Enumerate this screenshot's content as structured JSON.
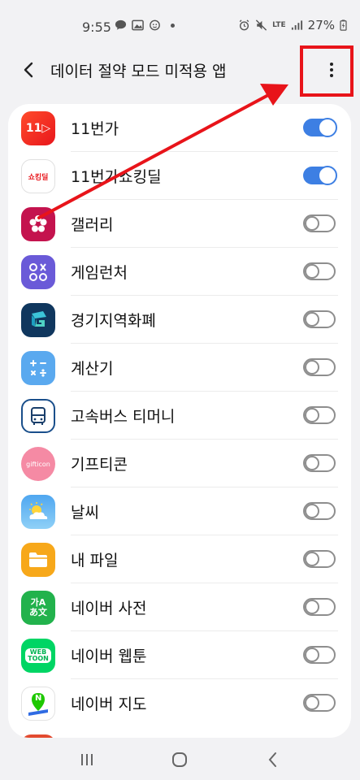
{
  "status_bar": {
    "time": "9:55",
    "battery": "27%",
    "network": "LTE"
  },
  "header": {
    "title": "데이터 절약 모드 미적용 앱"
  },
  "apps": [
    {
      "label": "11번가",
      "enabled": true
    },
    {
      "label": "11번가쇼킹딜",
      "enabled": true
    },
    {
      "label": "갤러리",
      "enabled": false
    },
    {
      "label": "게임런처",
      "enabled": false
    },
    {
      "label": "경기지역화폐",
      "enabled": false
    },
    {
      "label": "계산기",
      "enabled": false
    },
    {
      "label": "고속버스 티머니",
      "enabled": false
    },
    {
      "label": "기프티콘",
      "enabled": false
    },
    {
      "label": "날씨",
      "enabled": false
    },
    {
      "label": "내 파일",
      "enabled": false
    },
    {
      "label": "네이버 사전",
      "enabled": false
    },
    {
      "label": "네이버 웹툰",
      "enabled": false
    },
    {
      "label": "네이버 지도",
      "enabled": false
    }
  ],
  "icon_text": {
    "st11": "11",
    "shocking": "쇼킹딜",
    "gifticon": "gifticon",
    "dict": "가A",
    "dict2": "あ文",
    "webtoon": "WEB",
    "webtoon2": "TOON",
    "navermap": "N"
  },
  "colors": {
    "accent": "#3d7fe3",
    "highlight": "#e8141a"
  }
}
